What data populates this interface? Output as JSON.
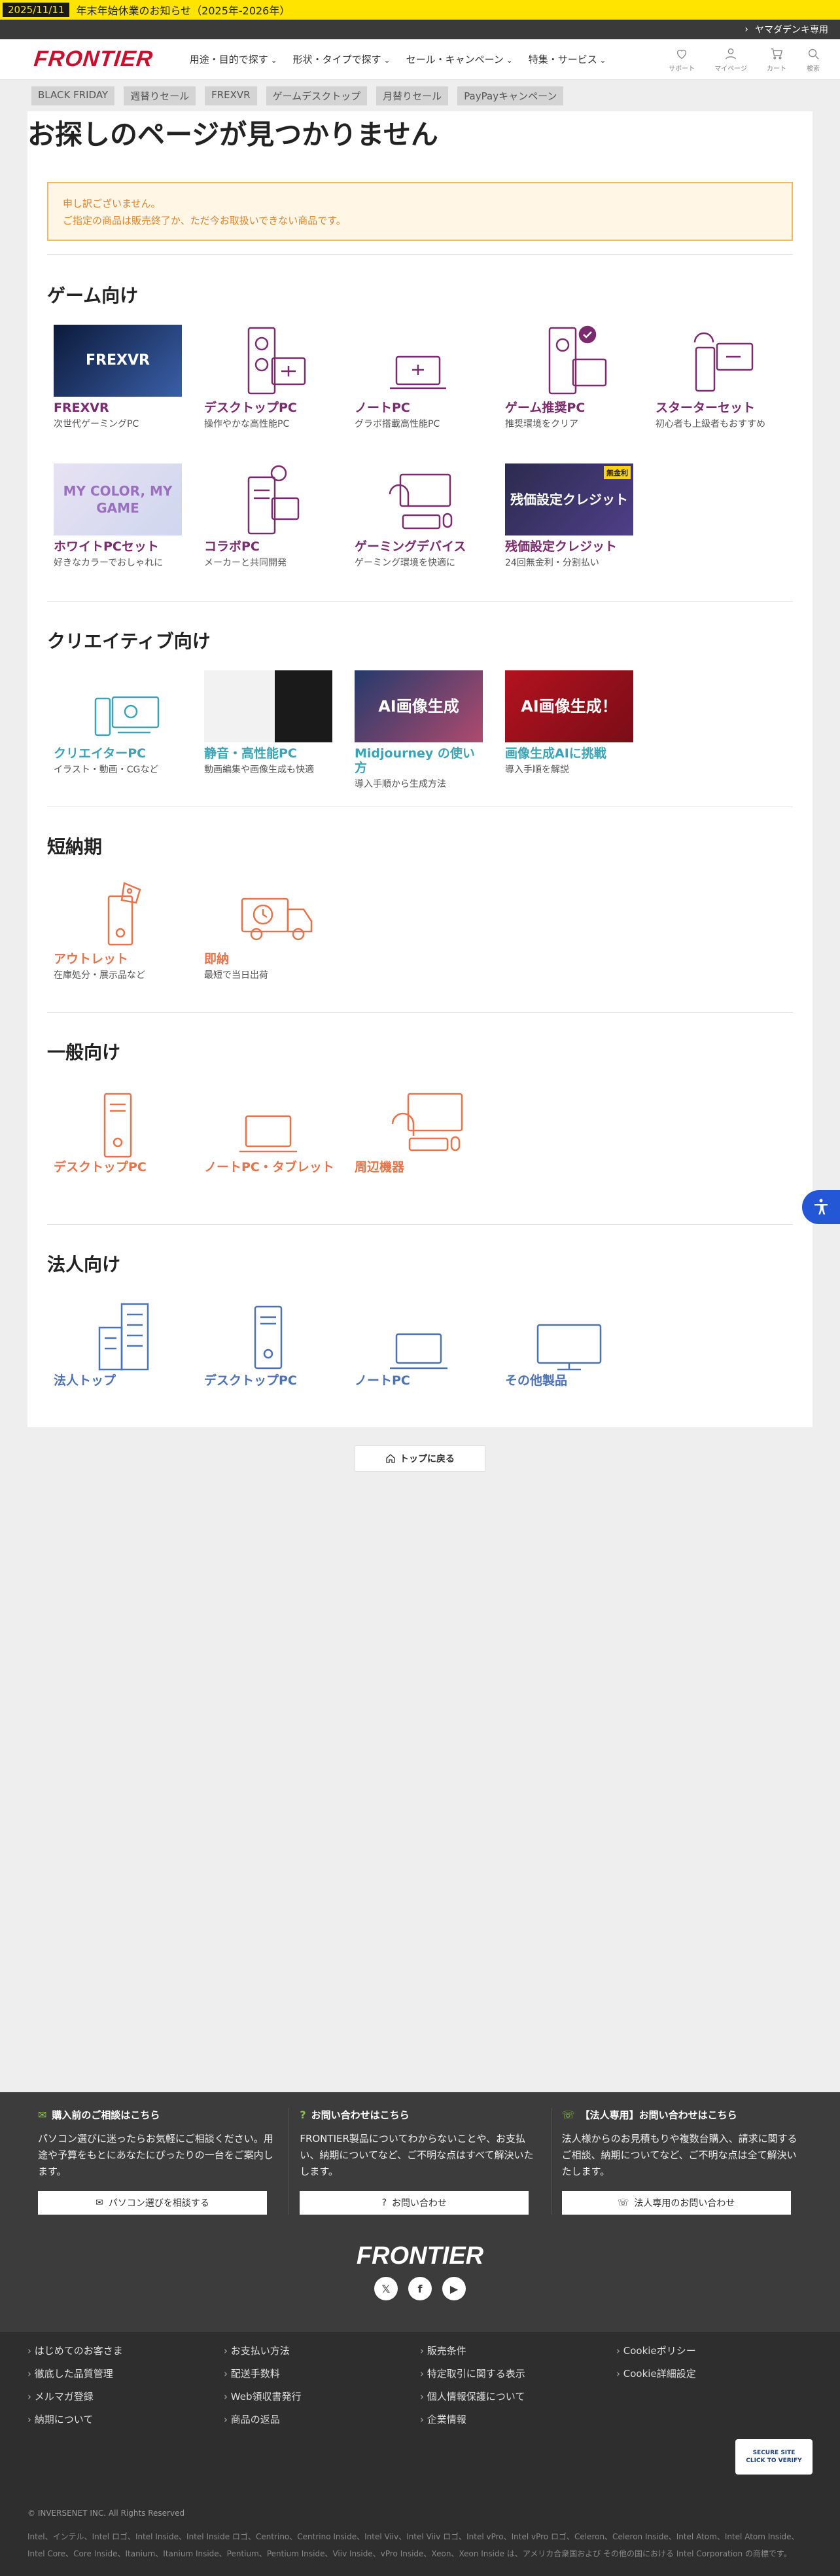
{
  "topbar": {
    "date": "2025/11/11",
    "news": "年末年始休業のお知らせ（2025年-2026年）"
  },
  "darkbar": {
    "link": "ヤマダデンキ専用"
  },
  "header": {
    "logo": "FRONTIER",
    "nav": [
      "用途・目的で探す",
      "形状・タイプで探す",
      "セール・キャンペーン",
      "特集・サービス"
    ],
    "util": [
      "サポート",
      "マイページ",
      "カート",
      "検索"
    ]
  },
  "tags": [
    "BLACK FRIDAY",
    "週替りセール",
    "FREXVR",
    "ゲームデスクトップ",
    "月替りセール",
    "PayPayキャンペーン"
  ],
  "page": {
    "title": "お探しのページが見つかりません",
    "notice_line1": "申し訳ございません。",
    "notice_line2": "ご指定の商品は販売終了か、ただ今お取扱いできない商品です。"
  },
  "sections": {
    "game": {
      "title": "ゲーム向け",
      "items": [
        {
          "name": "FREXVR",
          "sub": "次世代ゲーミングPC"
        },
        {
          "name": "デスクトップPC",
          "sub": "操作やかな高性能PC"
        },
        {
          "name": "ノートPC",
          "sub": "グラボ搭載高性能PC"
        },
        {
          "name": "ゲーム推奨PC",
          "sub": "推奨環境をクリア"
        },
        {
          "name": "スターターセット",
          "sub": "初心者も上級者もおすすめ"
        },
        {
          "name": "ホワイトPCセット",
          "sub": "好きなカラーでおしゃれに"
        },
        {
          "name": "コラボPC",
          "sub": "メーカーと共同開発"
        },
        {
          "name": "ゲーミングデバイス",
          "sub": "ゲーミング環境を快適に"
        },
        {
          "name": "残価設定クレジット",
          "sub": "24回無金利・分割払い"
        }
      ],
      "banners": {
        "frex": "FREXVR",
        "white": "MY COLOR, MY GAME",
        "credit": "残価設定クレジット",
        "credit_badge": "無金利"
      }
    },
    "creative": {
      "title": "クリエイティブ向け",
      "items": [
        {
          "name": "クリエイターPC",
          "sub": "イラスト・動画・CGなど"
        },
        {
          "name": "静音・高性能PC",
          "sub": "動画編集や画像生成も快適"
        },
        {
          "name": "Midjourney の使い方",
          "sub": "導入手順から生成方法"
        },
        {
          "name": "画像生成AIに挑戦",
          "sub": "導入手順を解説"
        }
      ],
      "banners": {
        "midj": "AI画像生成",
        "ai": "AI画像生成！"
      }
    },
    "quick": {
      "title": "短納期",
      "items": [
        {
          "name": "アウトレット",
          "sub": "在庫処分・展示品など"
        },
        {
          "name": "即納",
          "sub": "最短で当日出荷"
        }
      ]
    },
    "general": {
      "title": "一般向け",
      "items": [
        {
          "name": "デスクトップPC"
        },
        {
          "name": "ノートPC・タブレット"
        },
        {
          "name": "周辺機器"
        }
      ]
    },
    "business": {
      "title": "法人向け",
      "items": [
        {
          "name": "法人トップ"
        },
        {
          "name": "デスクトップPC"
        },
        {
          "name": "ノートPC"
        },
        {
          "name": "その他製品"
        }
      ]
    }
  },
  "back_button": "トップに戻る",
  "footer": {
    "contact": [
      {
        "title": "購入前のご相談はこちら",
        "text": "パソコン選びに迷ったらお気軽にご相談ください。用途や予算をもとにあなたにぴったりの一台をご案内します。",
        "button": "パソコン選びを相談する"
      },
      {
        "title": "お問い合わせはこちら",
        "text": "FRONTIER製品についてわからないことや、お支払い、納期についてなど、ご不明な点はすべて解決いたします。",
        "button": "お問い合わせ"
      },
      {
        "title": "【法人専用】お問い合わせはこちら",
        "text": "法人様からのお見積もりや複数台購入、請求に関するご相談、納期についてなど、ご不明な点は全て解決いたします。",
        "button": "法人専用のお問い合わせ"
      }
    ],
    "logo": "FRONTIER",
    "links": [
      "はじめてのお客さま",
      "お支払い方法",
      "販売条件",
      "Cookieポリシー",
      "徹底した品質管理",
      "配送手数料",
      "特定取引に関する表示",
      "Cookie詳細設定",
      "メルマガ登録",
      "Web領収書発行",
      "個人情報保護について",
      "",
      "納期について",
      "商品の返品",
      "企業情報",
      ""
    ],
    "seal": "SECURE SITE",
    "seal_sub": "CLICK TO VERIFY",
    "copyright": "© INVERSENET INC. All Rights Reserved",
    "legal": "Intel、インテル、Intel ロゴ、Intel Inside、Intel Inside ロゴ、Centrino、Centrino Inside、Intel Viiv、Intel Viiv ロゴ、Intel vPro、Intel vPro ロゴ、Celeron、Celeron Inside、Intel Atom、Intel Atom Inside、Intel Core、Core Inside、Itanium、Itanium Inside、Pentium、Pentium Inside、Viiv Inside、vPro Inside、Xeon、Xeon Inside は、アメリカ合衆国および その他の国における Intel Corporation の商標です。"
  }
}
